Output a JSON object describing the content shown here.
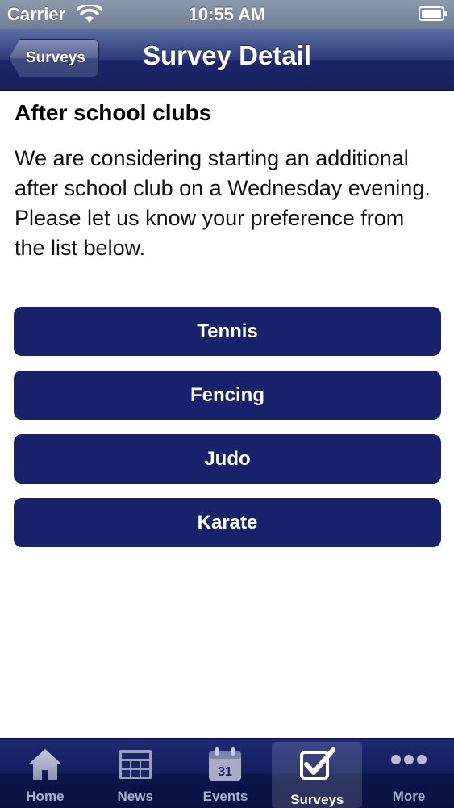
{
  "status_bar": {
    "carrier": "Carrier",
    "time": "10:55 AM"
  },
  "nav_bar": {
    "back_label": "Surveys",
    "title": "Survey Detail"
  },
  "survey": {
    "title": "After school clubs",
    "description": "We are considering starting an additional after school club on a Wednesday evening. Please let us know your preference from the list below.",
    "options": [
      {
        "label": "Tennis"
      },
      {
        "label": "Fencing"
      },
      {
        "label": "Judo"
      },
      {
        "label": "Karate"
      }
    ]
  },
  "tab_bar": {
    "selected": "Surveys",
    "tabs": [
      {
        "label": "Home",
        "icon": "home-icon"
      },
      {
        "label": "News",
        "icon": "newspaper-icon"
      },
      {
        "label": "Events",
        "icon": "calendar-icon",
        "calendar_day": "31"
      },
      {
        "label": "Surveys",
        "icon": "checkbox-icon"
      },
      {
        "label": "More",
        "icon": "more-dots-icon"
      }
    ]
  },
  "colors": {
    "nav_bar": "#1b266a",
    "option_button": "#18226a",
    "tab_bar": "#141d5c",
    "text": "#000000"
  }
}
